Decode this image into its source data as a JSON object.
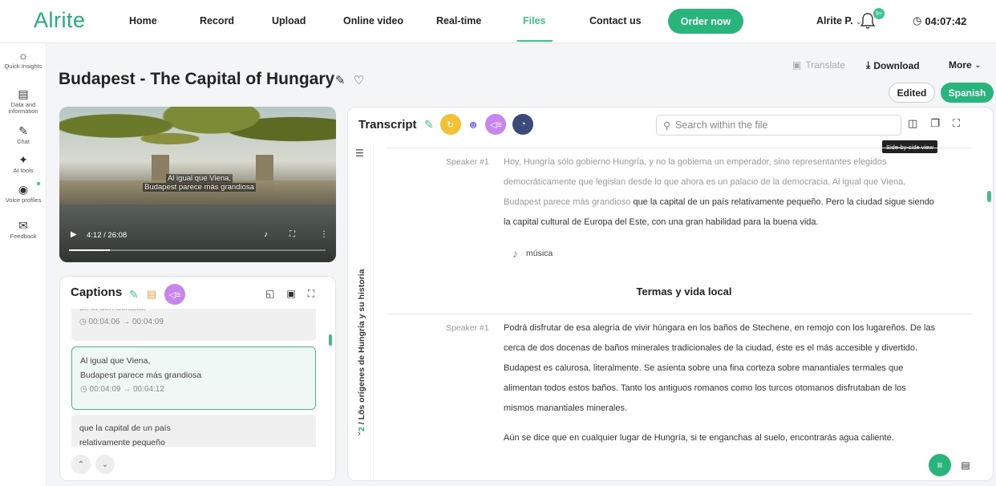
{
  "app": {
    "logo": "Alrite"
  },
  "nav": {
    "items": [
      "Home",
      "Record",
      "Upload",
      "Online video",
      "Real-time",
      "Files",
      "Contact us"
    ],
    "active": "Files",
    "order_label": "Order now",
    "user_label": "Alrite P.",
    "notif_count": "9+",
    "timer": "04:07:42"
  },
  "rail": [
    {
      "label": "Quick Insights",
      "icon": "bulb-icon"
    },
    {
      "label": "Data and information",
      "icon": "chart-icon"
    },
    {
      "label": "Chat",
      "icon": "chat-icon"
    },
    {
      "label": "AI tools",
      "icon": "sparkle-icon"
    },
    {
      "label": "Voice profiles",
      "icon": "voice-icon"
    },
    {
      "label": "Feedback",
      "icon": "feedback-icon"
    }
  ],
  "page": {
    "title": "Budapest - The Capital of Hungary",
    "translate_label": "Translate",
    "download_label": "Download",
    "more_label": "More",
    "edited_label": "Edited",
    "language_label": "Spanish"
  },
  "video": {
    "subtitle_line1": "Al igual que Viena,",
    "subtitle_line2": "Budapest parece más grandiosa",
    "time": "4:12 / 26:08",
    "progress": 0.16
  },
  "captions": {
    "heading": "Captions",
    "items": [
      {
        "text_line1": "de la democracia.",
        "text_line2": "",
        "time": "00:04:06 → 00:04:09"
      },
      {
        "text_line1": "Al igual que Viena,",
        "text_line2": "Budapest parece más grandiosa",
        "time": "00:04:09 → 00:04:12"
      },
      {
        "text_line1": "que la capital de un país",
        "text_line2": "relativamente pequeño",
        "time": ""
      }
    ]
  },
  "transcript": {
    "heading": "Transcript",
    "search_placeholder": "Search within the file",
    "tooltip": "Side-by-side view",
    "chapter_num": "2",
    "chapter_title": "/ Los orígenes de Hungría y su historia",
    "speaker1": "Speaker #1",
    "para1_lines": [
      "Hoy, Hungría sólo gobierno Hungría, y no la gobierna un emperador, sino representantes elegidos",
      "democráticamente que legislan desde lo que ahora es un palacio de la democracia. Al igual que Viena,",
      "Budapest parece más grandioso",
      " que la capital de un país relativamente pequeño. Pero la ciudad sigue siendo",
      "la capital cultural de Europa del Este, con una gran habilidad para la buena vida."
    ],
    "music_label": "música",
    "section_heading": "Termas y vida local",
    "speaker2": "Speaker #1",
    "para2_lines": [
      "Podrá disfrutar de esa alegría de vivir húngara en los baños de Stechene, en remojo con los lugareños. De las",
      "cerca de dos docenas de baños minerales tradicionales de la ciudad, éste es el más accesible y divertido.",
      "Budapest es calurosa, literalmente. Se asienta sobre una fina corteza sobre manantiales termales que",
      "alimentan todos estos baños. Tanto los antiguos romanos como los turcos otomanos disfrutaban de los",
      "mismos manantiales minerales."
    ],
    "para3": "Aún se dice que en cualquier lugar de Hungría, si te enganchas al suelo, encontrarás agua caliente."
  },
  "colors": {
    "accent": "#27b57b",
    "purple": "#b065e5",
    "yellow": "#f1c232",
    "navy": "#3a4a7a"
  }
}
